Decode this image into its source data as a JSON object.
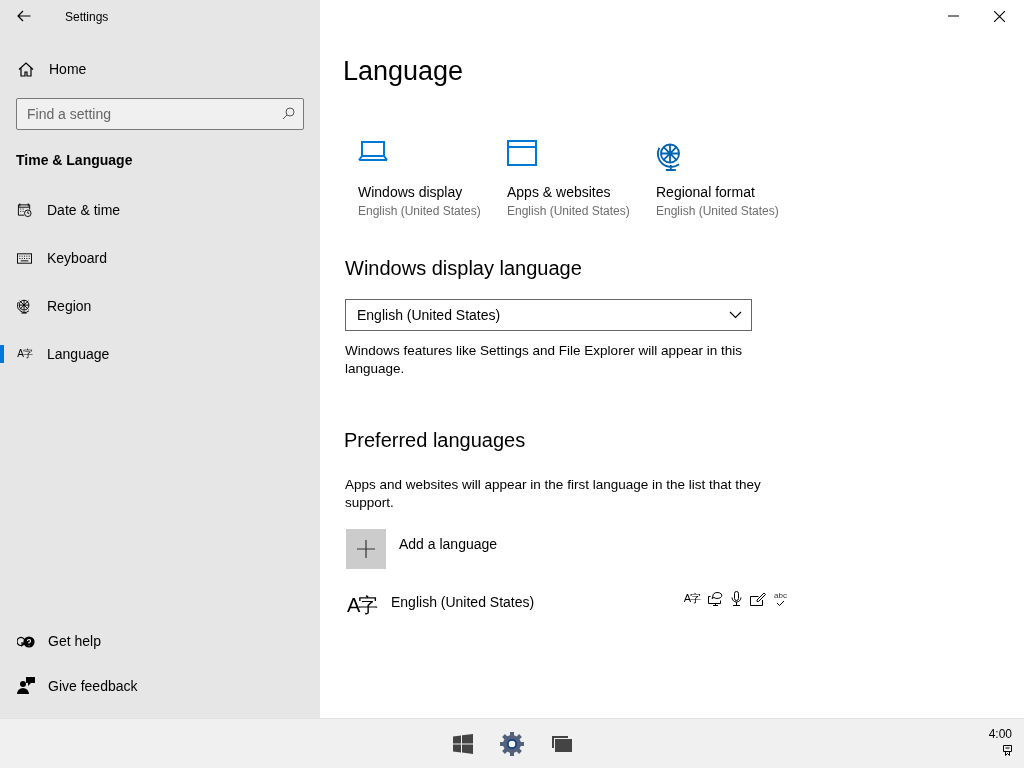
{
  "window": {
    "title": "Settings"
  },
  "sidebar": {
    "home": "Home",
    "search": {
      "placeholder": "Find a setting"
    },
    "section_title": "Time & Language",
    "items": [
      {
        "kind": "calendar",
        "label": "Date & time",
        "selected": false
      },
      {
        "kind": "keyboard",
        "label": "Keyboard",
        "selected": false
      },
      {
        "kind": "globe",
        "label": "Region",
        "selected": false
      },
      {
        "kind": "glyph",
        "glyph": "A字",
        "label": "Language",
        "selected": true
      }
    ],
    "footer_links": [
      {
        "kind": "help",
        "label": "Get help"
      },
      {
        "kind": "feedback",
        "label": "Give feedback"
      }
    ]
  },
  "page": {
    "title": "Language",
    "shortcuts": [
      {
        "kind": "laptop",
        "label": "Windows display",
        "value": "English (United States)"
      },
      {
        "kind": "window",
        "label": "Apps & websites",
        "value": "English (United States)"
      },
      {
        "kind": "globe",
        "label": "Regional format",
        "value": "English (United States)"
      }
    ],
    "display_language": {
      "heading": "Windows display language",
      "dropdown_value": "English (United States)",
      "description": "Windows features like Settings and File Explorer will appear in this language."
    },
    "preferred": {
      "heading": "Preferred languages",
      "description": "Apps and websites will appear in the first language in the list that they support.",
      "add_button": "Add a language",
      "languages": [
        {
          "glyph": "A字",
          "name": "English (United States)",
          "features": [
            {
              "kind": "glyph",
              "glyph": "A字"
            },
            {
              "kind": "speech"
            },
            {
              "kind": "microphone"
            },
            {
              "kind": "handwriting"
            },
            {
              "kind": "spelling",
              "glyph": "abc"
            }
          ]
        }
      ]
    }
  },
  "taskbar": {
    "clock": "4:00"
  }
}
